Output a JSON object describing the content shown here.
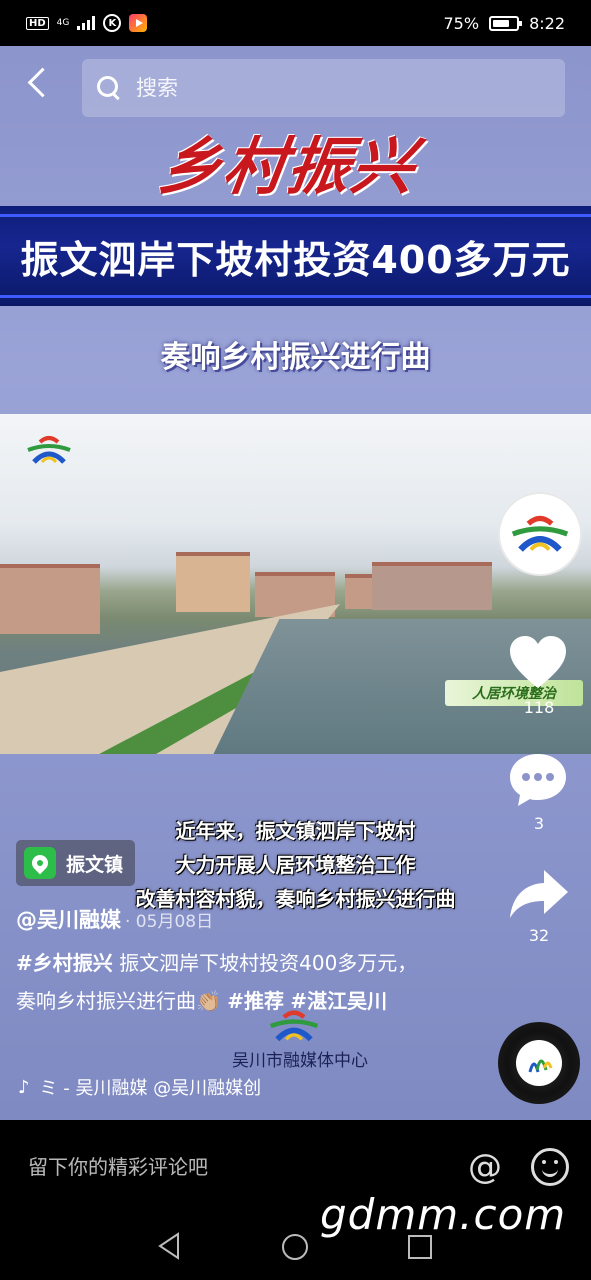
{
  "status_bar": {
    "network_hd": "HD",
    "network_gen": "4G",
    "battery_percent": "75%",
    "time": "8:22",
    "icons": [
      "hd-icon",
      "signal-icon",
      "k-app-icon",
      "video-app-icon",
      "battery-icon"
    ]
  },
  "search": {
    "placeholder": "搜索"
  },
  "video": {
    "title_art": "乡村振兴",
    "headline": "振文泗岸下坡村投资400多万元",
    "subtitle": "奏响乡村振兴进行曲",
    "scene_tag": "人居环境整治",
    "captions": [
      "近年来，振文镇泗岸下坡村",
      "大力开展人居环境整治工作",
      "改善村容村貌，奏响乡村振兴进行曲"
    ],
    "watermark_org": "吴川市融媒体中心"
  },
  "actions": {
    "like_count": "118",
    "comment_count": "3",
    "share_count": "32",
    "like_color": "#ffffff"
  },
  "post": {
    "location": "振文镇",
    "author": "@吴川融媒",
    "date": "· 05月08日",
    "description_parts": [
      {
        "type": "tag",
        "text": "#乡村振兴"
      },
      {
        "type": "text",
        "text": " 振文泗岸下坡村投资400多万元，奏响乡村振兴进行曲👏🏼 "
      },
      {
        "type": "tag",
        "text": "#推荐"
      },
      {
        "type": "text",
        "text": " "
      },
      {
        "type": "tag",
        "text": "#湛江吴川"
      }
    ],
    "music_text": "ミ - 吴川融媒   @吴川融媒创"
  },
  "comment_bar": {
    "placeholder": "留下你的精彩评论吧",
    "at_symbol": "@"
  },
  "site_watermark": "gdmm.com"
}
